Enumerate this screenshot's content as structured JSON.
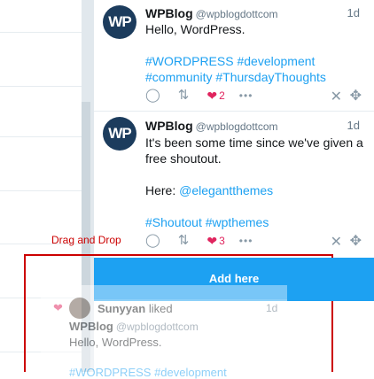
{
  "tweets": [
    {
      "author": "WPBlog",
      "handle": "@wpblogdottcom",
      "time": "1d",
      "avatar_text": "WP",
      "lines": [
        "Hello, WordPress.",
        "",
        "#WORDPRESS #development",
        "#community #ThursdayThoughts"
      ],
      "likes": "2"
    },
    {
      "author": "WPBlog",
      "handle": "@wpblogdottcom",
      "time": "1d",
      "avatar_text": "WP",
      "lines": [
        "It's been some time since we've given a",
        "free shoutout.",
        "",
        "Here: @elegantthemes",
        "",
        "#Shoutout #wpthemes"
      ],
      "likes": "3"
    }
  ],
  "icons": {
    "reply": "reply-icon",
    "retweet": "retweet-icon",
    "like": "heart-icon",
    "more": "more-icon",
    "close": "close-icon",
    "move": "move-icon"
  },
  "drag": {
    "label": "Drag and Drop",
    "drop_button": "Add here"
  },
  "ghost": {
    "liker": "Sunyyan",
    "liked_text": "liked",
    "time": "1d",
    "author": "WPBlog",
    "handle": "@wpblogdottcom",
    "text": "Hello, WordPress.",
    "tags": "#WORDPRESS #development"
  },
  "colors": {
    "accent": "#1da1f2",
    "like": "#e0245e",
    "annotation": "#cc0000"
  }
}
